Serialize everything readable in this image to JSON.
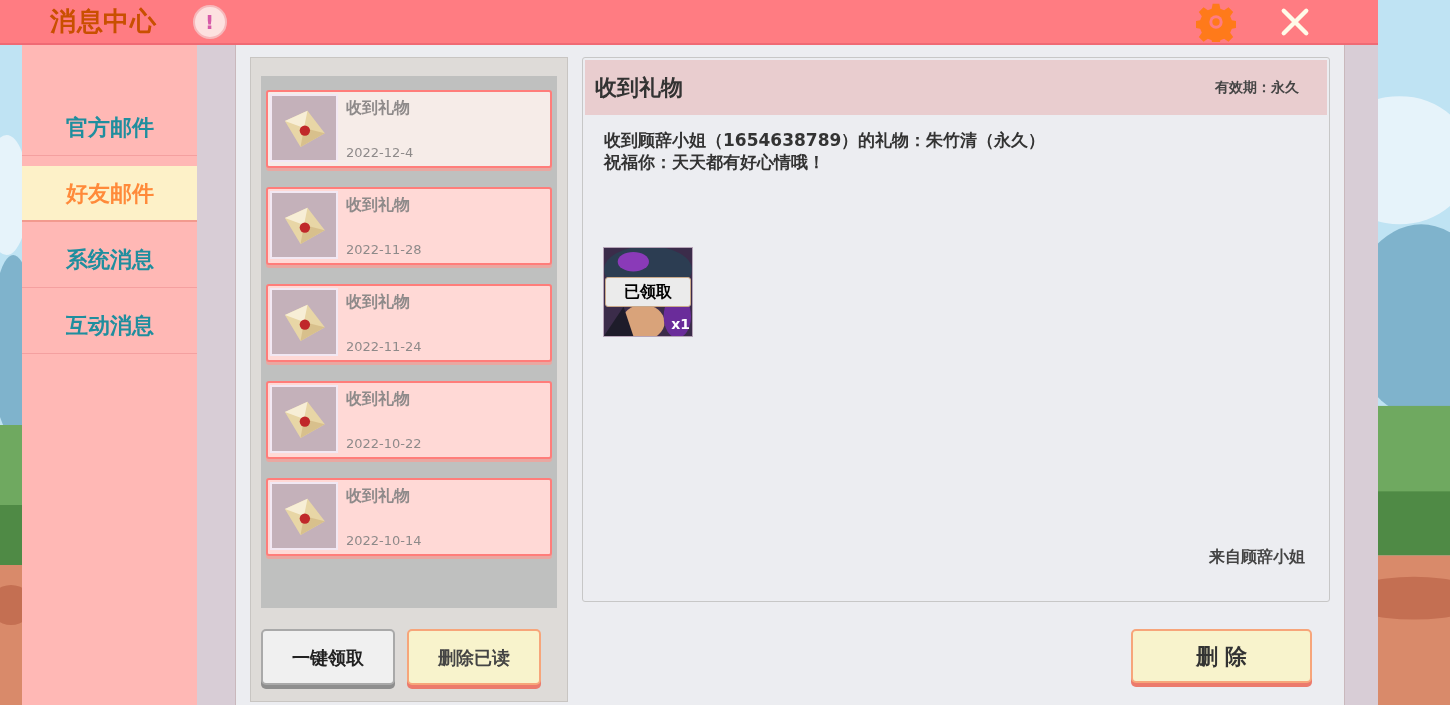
{
  "header": {
    "title": "消息中心",
    "alert": "!"
  },
  "sidebar": {
    "items": [
      {
        "label": "官方邮件",
        "selected": false
      },
      {
        "label": "好友邮件",
        "selected": true
      },
      {
        "label": "系统消息",
        "selected": false
      },
      {
        "label": "互动消息",
        "selected": false
      }
    ]
  },
  "mail_list": {
    "items": [
      {
        "title": "收到礼物",
        "date": "2022-12-4",
        "selected": true
      },
      {
        "title": "收到礼物",
        "date": "2022-11-28",
        "selected": false
      },
      {
        "title": "收到礼物",
        "date": "2022-11-24",
        "selected": false
      },
      {
        "title": "收到礼物",
        "date": "2022-10-22",
        "selected": false
      },
      {
        "title": "收到礼物",
        "date": "2022-10-14",
        "selected": false
      }
    ],
    "buttons": [
      "一键领取",
      "删除已读"
    ]
  },
  "detail": {
    "title": "收到礼物",
    "validity": "有效期：永久",
    "body": [
      "收到顾辞小姐（1654638789）的礼物：朱竹清（永久）",
      "祝福你：天天都有好心情哦！"
    ],
    "attachment": {
      "status": "已领取",
      "count": "x1",
      "claimed": true
    },
    "sender": "来自顾辞小姐",
    "button": "删 除"
  }
}
